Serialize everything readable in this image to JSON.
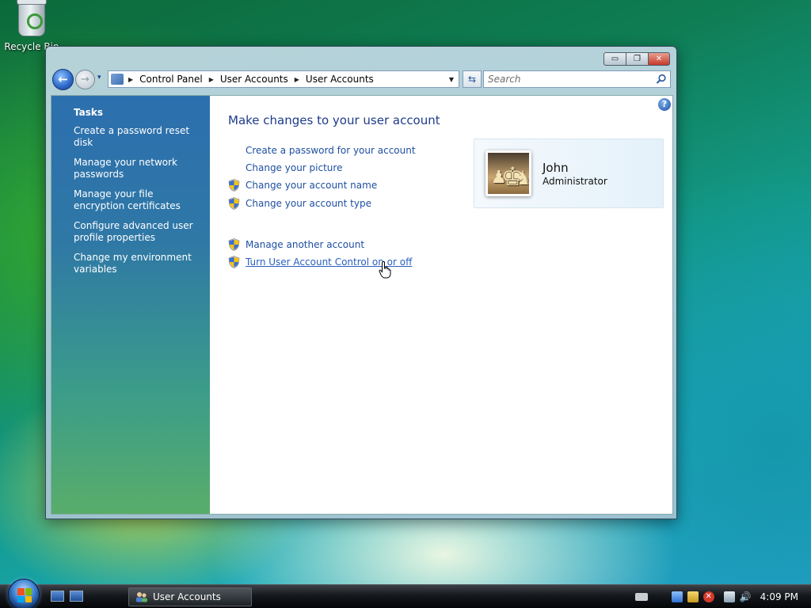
{
  "desktop": {
    "recycle_bin_label": "Recycle Bin"
  },
  "window": {
    "title": "User Accounts",
    "caption": {
      "minimize_glyph": "▭",
      "maximize_glyph": "❐",
      "close_glyph": "✕"
    },
    "navigation": {
      "back_glyph": "←",
      "forward_glyph": "→",
      "recent_glyph": "▾",
      "refresh_glyph": "⇆"
    },
    "address_bar": {
      "crumbs": [
        "Control Panel",
        "User Accounts",
        "User Accounts"
      ],
      "separator": "▶",
      "dropdown_glyph": "▼"
    },
    "search": {
      "placeholder": "Search"
    }
  },
  "task_pane": {
    "heading": "Tasks",
    "links": [
      "Create a password reset disk",
      "Manage your network passwords",
      "Manage your file encryption certificates",
      "Configure advanced user profile properties",
      "Change my environment variables"
    ]
  },
  "main": {
    "help_glyph": "?",
    "title": "Make changes to your user account",
    "links": [
      {
        "label": "Create a password for your account",
        "shield": false
      },
      {
        "label": "Change your picture",
        "shield": false
      },
      {
        "label": "Change your account name",
        "shield": true
      },
      {
        "label": "Change your account type",
        "shield": true
      },
      {
        "label": "Manage another account",
        "shield": true
      },
      {
        "label": "Turn User Account Control on or off",
        "shield": true
      }
    ]
  },
  "user_card": {
    "name": "John",
    "role": "Administrator",
    "picture": "chess-pieces"
  },
  "taskbar": {
    "open_window_label": "User Accounts",
    "clock": "4:09 PM"
  },
  "colors": {
    "link_blue": "#1e4fa0",
    "title_blue": "#1e3b8a",
    "task_pane_top": "#2c6fae",
    "task_pane_bottom": "#58ad6a"
  }
}
